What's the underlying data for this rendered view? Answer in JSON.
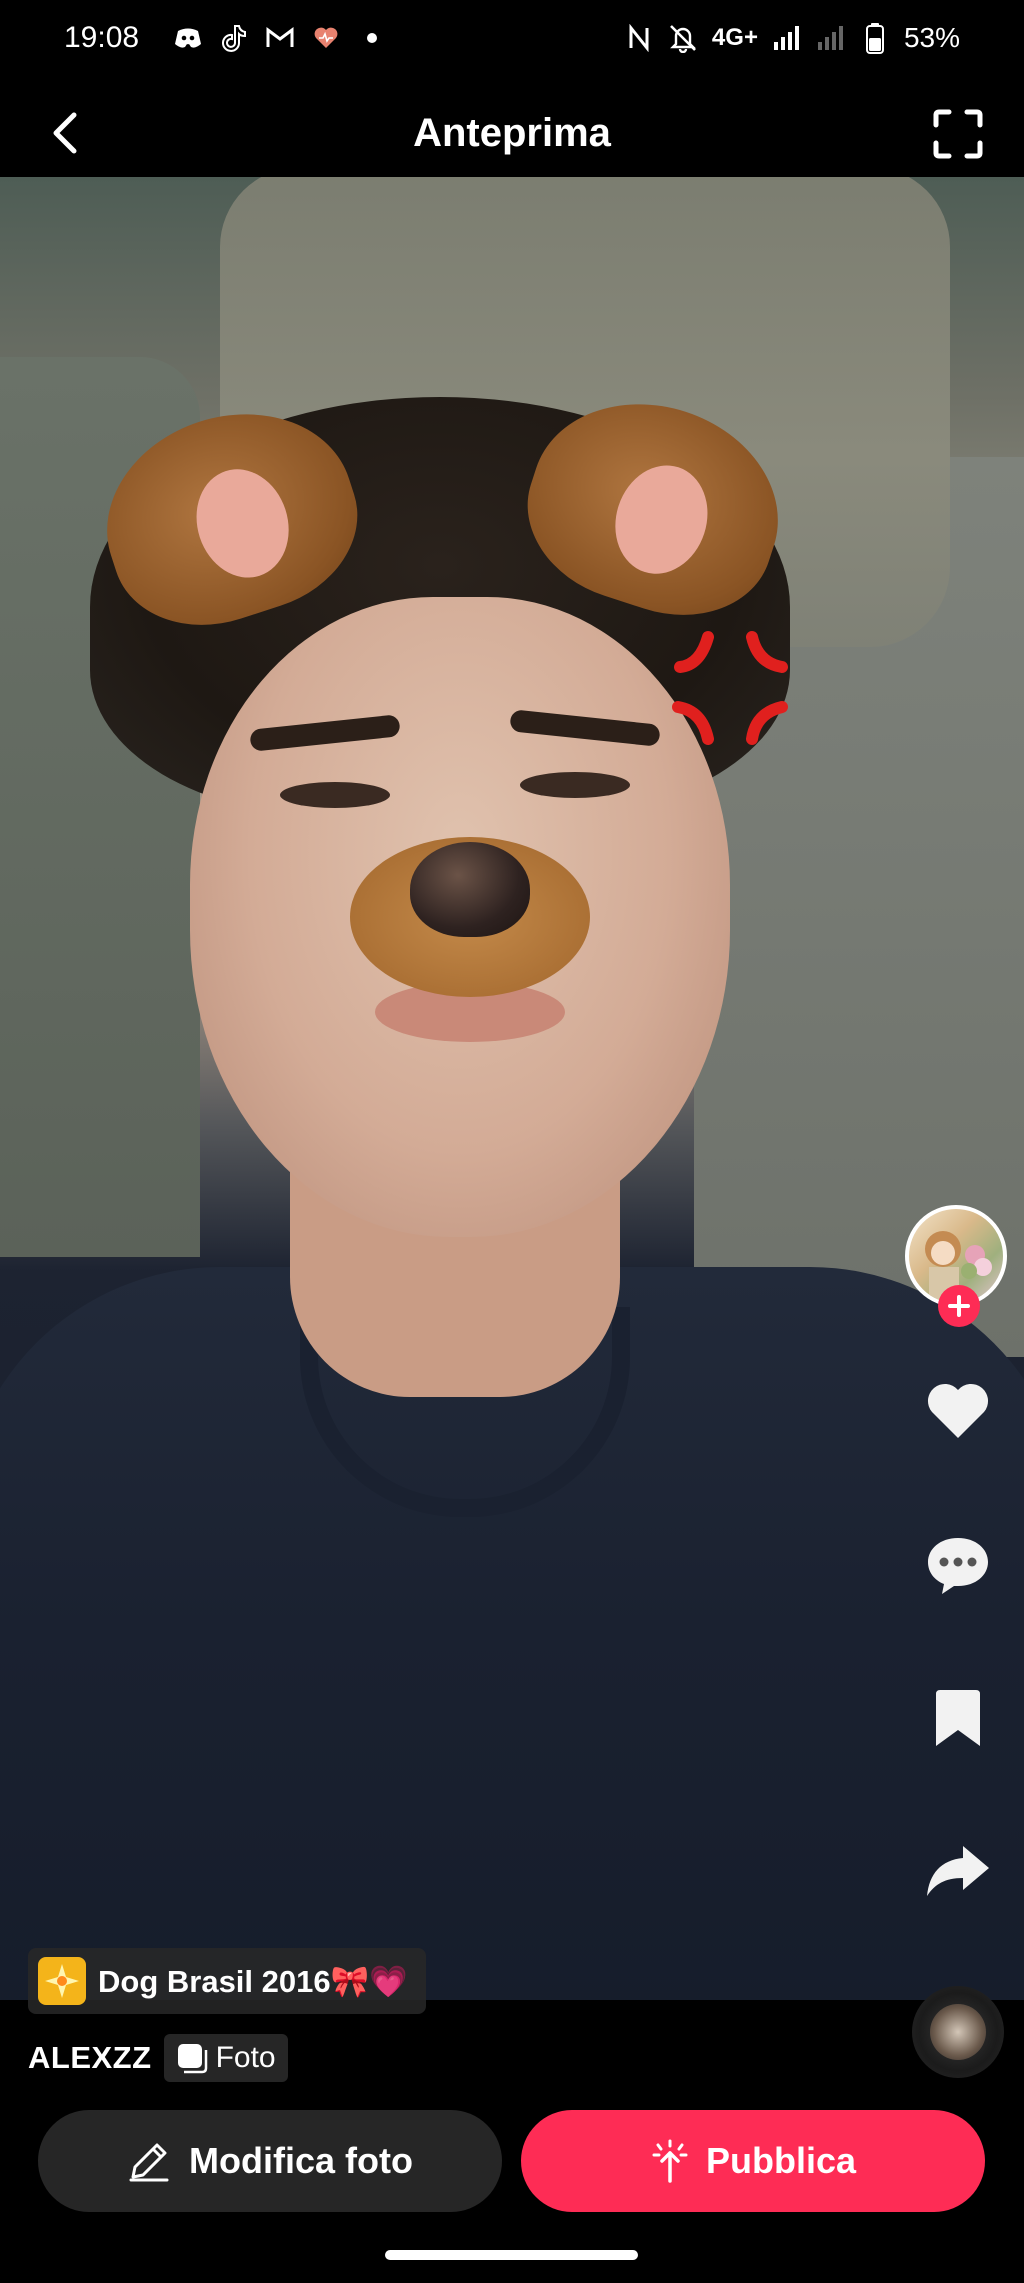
{
  "status_bar": {
    "time": "19:08",
    "network": "4G+",
    "battery": "53%",
    "notification_icons": [
      "discord-icon",
      "tiktok-icon",
      "gmail-icon",
      "heart-app-icon",
      "dot-icon"
    ]
  },
  "header": {
    "title": "Anteprima"
  },
  "effect": {
    "label": "Dog Brasil 2016🎀💗"
  },
  "post": {
    "username": "ALEXZZ",
    "type_label": "Foto"
  },
  "actions": {
    "edit_label": "Modifica foto",
    "publish_label": "Pubblica"
  },
  "colors": {
    "accent": "#fe2c55",
    "button_dark": "#262626",
    "background": "#000000"
  }
}
